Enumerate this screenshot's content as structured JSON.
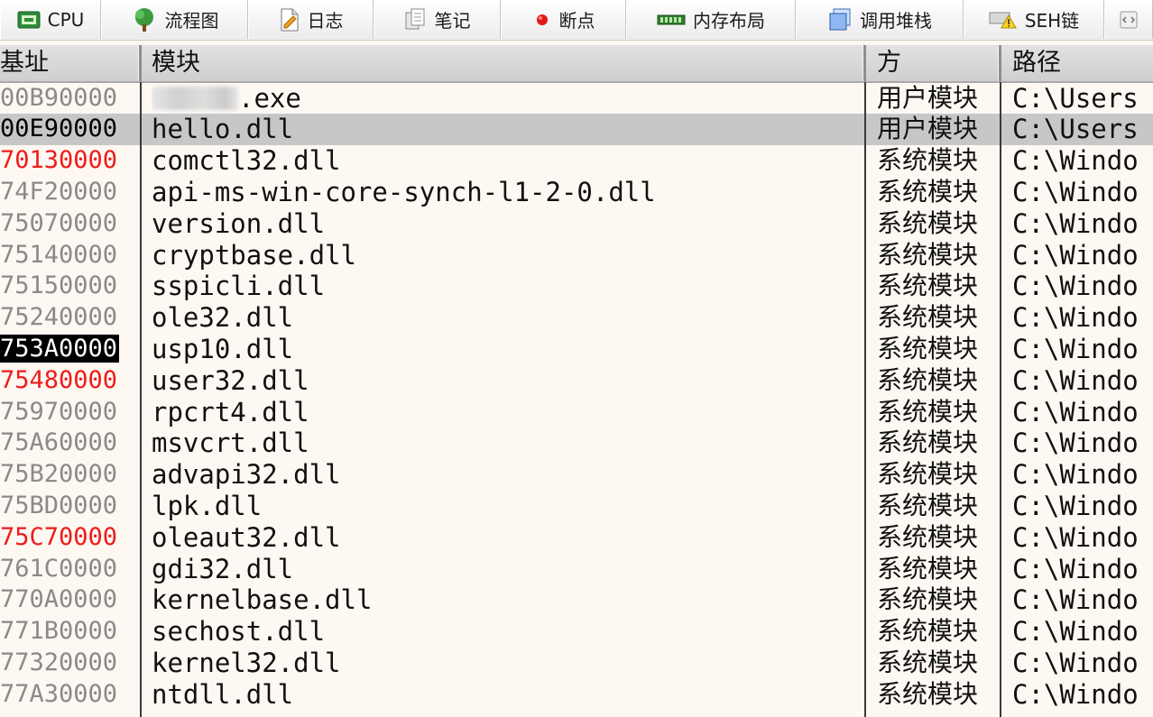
{
  "toolbar": {
    "tabs": [
      {
        "label": "CPU",
        "icon": "cpu-chip-icon"
      },
      {
        "label": "流程图",
        "icon": "tree-icon"
      },
      {
        "label": "日志",
        "icon": "log-document-icon"
      },
      {
        "label": "笔记",
        "icon": "notes-icon"
      },
      {
        "label": "断点",
        "icon": "breakpoint-dot-icon"
      },
      {
        "label": "内存布局",
        "icon": "memory-map-icon"
      },
      {
        "label": "调用堆栈",
        "icon": "call-stack-icon"
      },
      {
        "label": "SEH链",
        "icon": "seh-warning-icon"
      }
    ]
  },
  "table": {
    "columns": {
      "base": "基址",
      "module": "模块",
      "party": "方",
      "path": "路径"
    },
    "rows": [
      {
        "base": "00B90000",
        "module": ".exe",
        "party": "用户模块",
        "path": "C:\\Users",
        "color": "gray",
        "redacted": true
      },
      {
        "base": "00E90000",
        "module": "hello.dll",
        "party": "用户模块",
        "path": "C:\\Users",
        "color": "dark",
        "selected": true
      },
      {
        "base": "70130000",
        "module": "comctl32.dll",
        "party": "系统模块",
        "path": "C:\\Windo",
        "color": "red"
      },
      {
        "base": "74F20000",
        "module": "api-ms-win-core-synch-l1-2-0.dll",
        "party": "系统模块",
        "path": "C:\\Windo",
        "color": "gray"
      },
      {
        "base": "75070000",
        "module": "version.dll",
        "party": "系统模块",
        "path": "C:\\Windo",
        "color": "gray"
      },
      {
        "base": "75140000",
        "module": "cryptbase.dll",
        "party": "系统模块",
        "path": "C:\\Windo",
        "color": "gray"
      },
      {
        "base": "75150000",
        "module": "sspicli.dll",
        "party": "系统模块",
        "path": "C:\\Windo",
        "color": "gray"
      },
      {
        "base": "75240000",
        "module": "ole32.dll",
        "party": "系统模块",
        "path": "C:\\Windo",
        "color": "gray"
      },
      {
        "base": "753A0000",
        "module": "usp10.dll",
        "party": "系统模块",
        "path": "C:\\Windo",
        "color": "highlight"
      },
      {
        "base": "75480000",
        "module": "user32.dll",
        "party": "系统模块",
        "path": "C:\\Windo",
        "color": "red"
      },
      {
        "base": "75970000",
        "module": "rpcrt4.dll",
        "party": "系统模块",
        "path": "C:\\Windo",
        "color": "gray"
      },
      {
        "base": "75A60000",
        "module": "msvcrt.dll",
        "party": "系统模块",
        "path": "C:\\Windo",
        "color": "gray"
      },
      {
        "base": "75B20000",
        "module": "advapi32.dll",
        "party": "系统模块",
        "path": "C:\\Windo",
        "color": "gray"
      },
      {
        "base": "75BD0000",
        "module": "lpk.dll",
        "party": "系统模块",
        "path": "C:\\Windo",
        "color": "gray"
      },
      {
        "base": "75C70000",
        "module": "oleaut32.dll",
        "party": "系统模块",
        "path": "C:\\Windo",
        "color": "red"
      },
      {
        "base": "761C0000",
        "module": "gdi32.dll",
        "party": "系统模块",
        "path": "C:\\Windo",
        "color": "gray"
      },
      {
        "base": "770A0000",
        "module": "kernelbase.dll",
        "party": "系统模块",
        "path": "C:\\Windo",
        "color": "gray"
      },
      {
        "base": "771B0000",
        "module": "sechost.dll",
        "party": "系统模块",
        "path": "C:\\Windo",
        "color": "gray"
      },
      {
        "base": "77320000",
        "module": "kernel32.dll",
        "party": "系统模块",
        "path": "C:\\Windo",
        "color": "gray"
      },
      {
        "base": "77A30000",
        "module": "ntdll.dll",
        "party": "系统模块",
        "path": "C:\\Windo",
        "color": "gray"
      }
    ]
  },
  "colors": {
    "address_gray": "#8a8a8a",
    "address_red": "#ee1c1c",
    "selected_row": "#c7c7c7",
    "background": "#fdf8f2"
  }
}
